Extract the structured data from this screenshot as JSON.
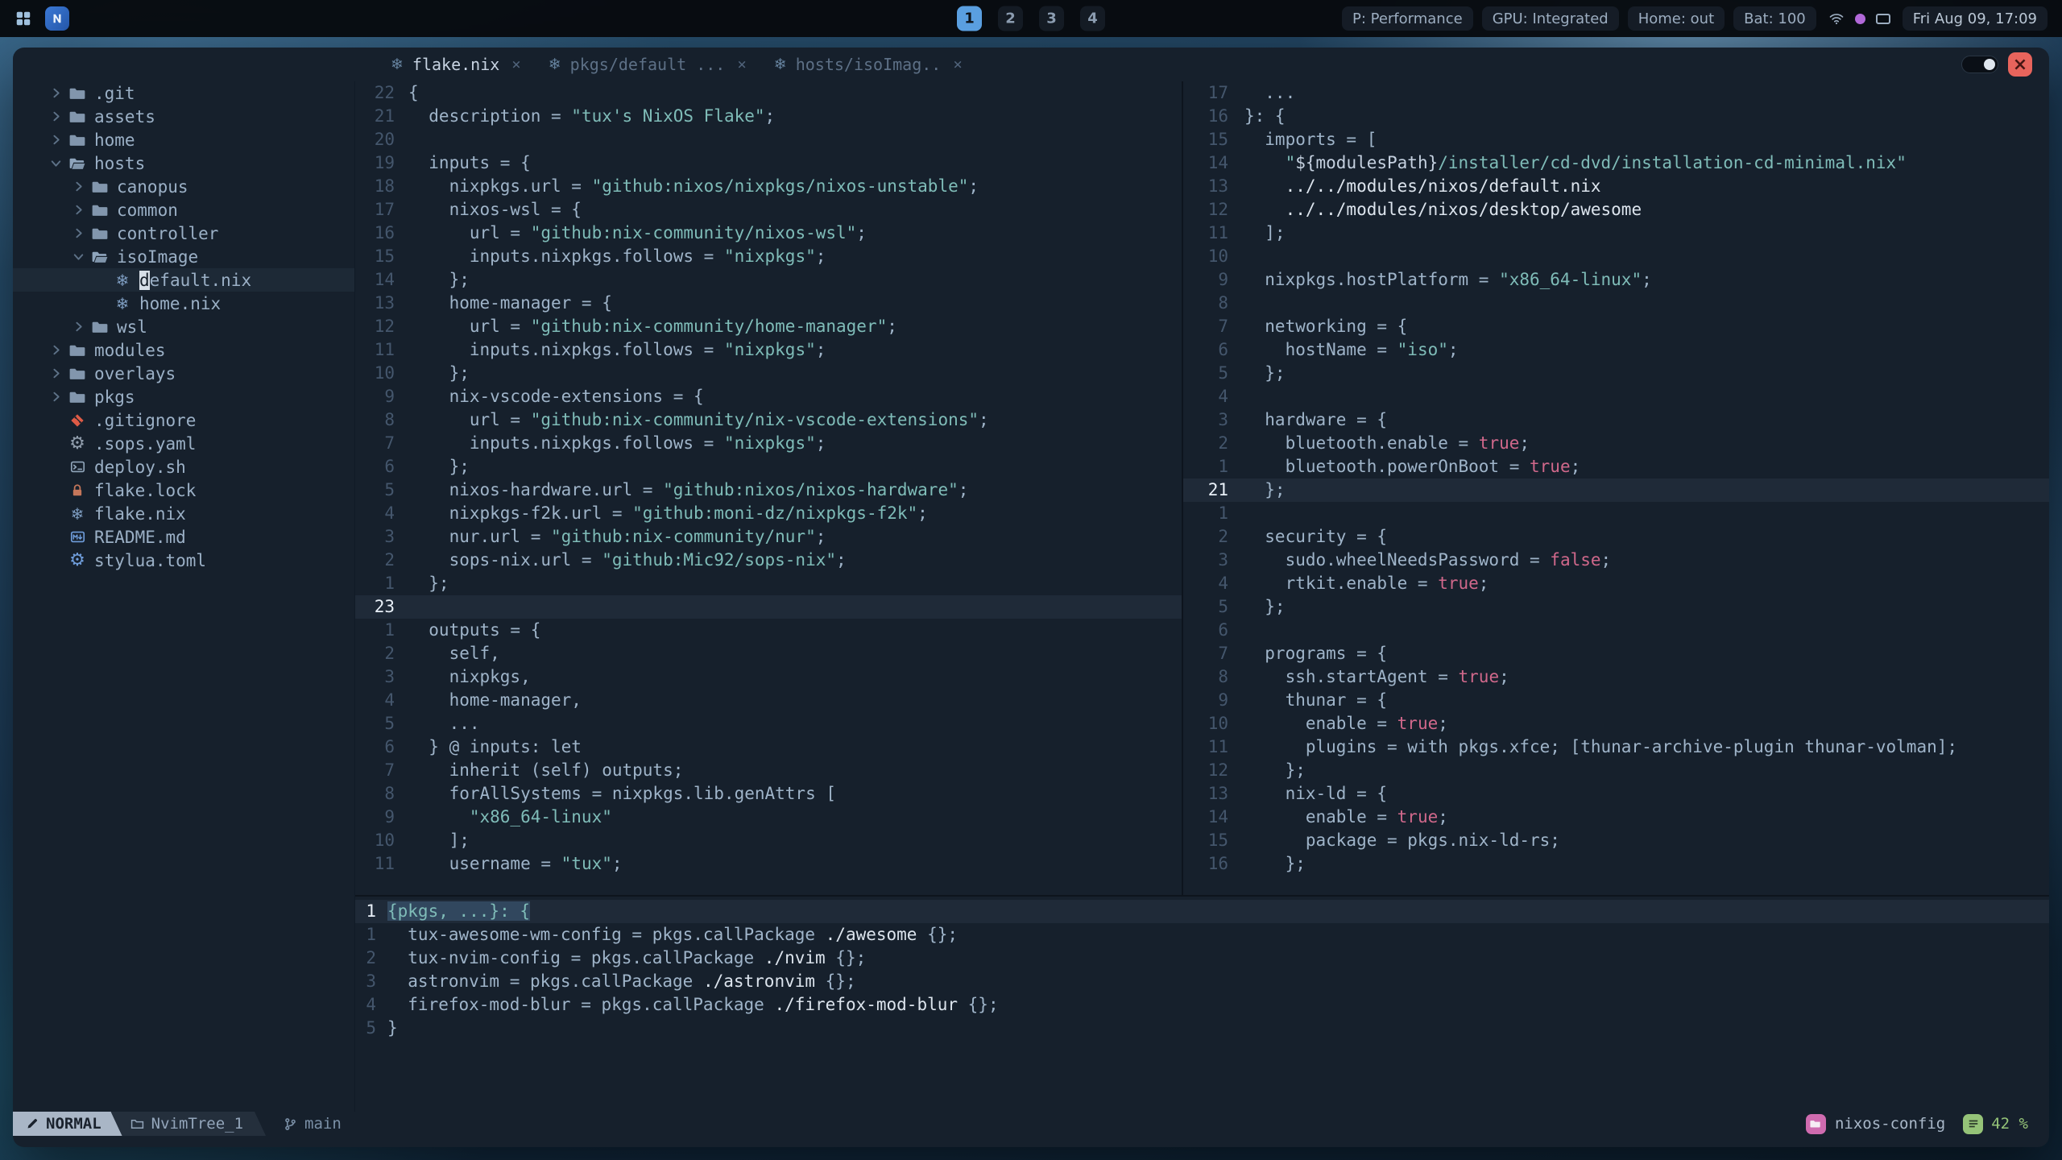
{
  "colors": {
    "accent_blue": "#5a9fe0",
    "string_teal": "#7fbcb8",
    "bool_pink": "#d0688b",
    "close_red": "#e8645c",
    "project_pink": "#cf6baf",
    "percent_green": "#95c378"
  },
  "topbar": {
    "workspaces": [
      {
        "label": "1",
        "active": true
      },
      {
        "label": "2",
        "active": false
      },
      {
        "label": "3",
        "active": false
      },
      {
        "label": "4",
        "active": false
      }
    ],
    "status_items": [
      {
        "label": "P: Performance"
      },
      {
        "label": "GPU: Integrated"
      },
      {
        "label": "Home: out"
      },
      {
        "label": "Bat: 100"
      }
    ],
    "clock": "Fri Aug 09, 17:09"
  },
  "tabline": {
    "tabs": [
      {
        "label": "flake.nix",
        "icon": "nix",
        "active": true
      },
      {
        "label": "pkgs/default ...",
        "icon": "nix",
        "active": false
      },
      {
        "label": "hosts/isoImag..",
        "icon": "nix",
        "active": false
      }
    ]
  },
  "tree": {
    "items": [
      {
        "label": ".git",
        "icon": "folder",
        "chevron": "closed",
        "depth": 0
      },
      {
        "label": "assets",
        "icon": "folder",
        "chevron": "closed",
        "depth": 0
      },
      {
        "label": "home",
        "icon": "folder",
        "chevron": "closed",
        "depth": 0
      },
      {
        "label": "hosts",
        "icon": "folder-open",
        "chevron": "open",
        "depth": 0
      },
      {
        "label": "canopus",
        "icon": "folder",
        "chevron": "closed",
        "depth": 1
      },
      {
        "label": "common",
        "icon": "folder",
        "chevron": "closed",
        "depth": 1
      },
      {
        "label": "controller",
        "icon": "folder",
        "chevron": "closed",
        "depth": 1
      },
      {
        "label": "isoImage",
        "icon": "folder-open",
        "chevron": "open",
        "depth": 1
      },
      {
        "label": "default.nix",
        "icon": "nix",
        "depth": 2,
        "cursor": true
      },
      {
        "label": "home.nix",
        "icon": "nix",
        "depth": 2
      },
      {
        "label": "wsl",
        "icon": "folder",
        "chevron": "closed",
        "depth": 1
      },
      {
        "label": "modules",
        "icon": "folder",
        "chevron": "closed",
        "depth": 0
      },
      {
        "label": "overlays",
        "icon": "folder",
        "chevron": "closed",
        "depth": 0
      },
      {
        "label": "pkgs",
        "icon": "folder",
        "chevron": "closed",
        "depth": 0
      },
      {
        "label": ".gitignore",
        "icon": "git",
        "depth": 0
      },
      {
        "label": ".sops.yaml",
        "icon": "gear-gray",
        "depth": 0
      },
      {
        "label": "deploy.sh",
        "icon": "terminal",
        "depth": 0
      },
      {
        "label": "flake.lock",
        "icon": "lock",
        "depth": 0
      },
      {
        "label": "flake.nix",
        "icon": "nix",
        "depth": 0
      },
      {
        "label": "README.md",
        "icon": "readme",
        "depth": 0
      },
      {
        "label": "stylua.toml",
        "icon": "gear-blue",
        "depth": 0
      }
    ]
  },
  "editors": {
    "flake": {
      "lines": [
        {
          "n": "22",
          "t": "{"
        },
        {
          "n": "21",
          "t": "  description = \"tux's NixOS Flake\";"
        },
        {
          "n": "20",
          "t": ""
        },
        {
          "n": "19",
          "t": "  inputs = {"
        },
        {
          "n": "18",
          "t": "    nixpkgs.url = \"github:nixos/nixpkgs/nixos-unstable\";"
        },
        {
          "n": "17",
          "t": "    nixos-wsl = {"
        },
        {
          "n": "16",
          "t": "      url = \"github:nix-community/nixos-wsl\";"
        },
        {
          "n": "15",
          "t": "      inputs.nixpkgs.follows = \"nixpkgs\";"
        },
        {
          "n": "14",
          "t": "    };"
        },
        {
          "n": "13",
          "t": "    home-manager = {"
        },
        {
          "n": "12",
          "t": "      url = \"github:nix-community/home-manager\";"
        },
        {
          "n": "11",
          "t": "      inputs.nixpkgs.follows = \"nixpkgs\";"
        },
        {
          "n": "10",
          "t": "    };"
        },
        {
          "n": "9",
          "t": "    nix-vscode-extensions = {"
        },
        {
          "n": "8",
          "t": "      url = \"github:nix-community/nix-vscode-extensions\";"
        },
        {
          "n": "7",
          "t": "      inputs.nixpkgs.follows = \"nixpkgs\";"
        },
        {
          "n": "6",
          "t": "    };"
        },
        {
          "n": "5",
          "t": "    nixos-hardware.url = \"github:nixos/nixos-hardware\";"
        },
        {
          "n": "4",
          "t": "    nixpkgs-f2k.url = \"github:moni-dz/nixpkgs-f2k\";"
        },
        {
          "n": "3",
          "t": "    nur.url = \"github:nix-community/nur\";"
        },
        {
          "n": "2",
          "t": "    sops-nix.url = \"github:Mic92/sops-nix\";"
        },
        {
          "n": "1",
          "t": "  };"
        },
        {
          "n": "23",
          "t": "",
          "cur": true
        },
        {
          "n": "1",
          "t": "  outputs = {"
        },
        {
          "n": "2",
          "t": "    self,"
        },
        {
          "n": "3",
          "t": "    nixpkgs,"
        },
        {
          "n": "4",
          "t": "    home-manager,"
        },
        {
          "n": "5",
          "t": "    ..."
        },
        {
          "n": "6",
          "t": "  } @ inputs: let"
        },
        {
          "n": "7",
          "t": "    inherit (self) outputs;"
        },
        {
          "n": "8",
          "t": "    forAllSystems = nixpkgs.lib.genAttrs ["
        },
        {
          "n": "9",
          "t": "      \"x86_64-linux\""
        },
        {
          "n": "10",
          "t": "    ];"
        },
        {
          "n": "11",
          "t": "    username = \"tux\";"
        }
      ]
    },
    "hosts": {
      "lines": [
        {
          "n": "17",
          "t": "  ..."
        },
        {
          "n": "16",
          "t": "}: {"
        },
        {
          "n": "15",
          "t": "  imports = ["
        },
        {
          "n": "14",
          "t": "    \"${modulesPath}/installer/cd-dvd/installation-cd-minimal.nix\""
        },
        {
          "n": "13",
          "t": "    ../../modules/nixos/default.nix"
        },
        {
          "n": "12",
          "t": "    ../../modules/nixos/desktop/awesome"
        },
        {
          "n": "11",
          "t": "  ];"
        },
        {
          "n": "10",
          "t": ""
        },
        {
          "n": "9",
          "t": "  nixpkgs.hostPlatform = \"x86_64-linux\";"
        },
        {
          "n": "8",
          "t": ""
        },
        {
          "n": "7",
          "t": "  networking = {"
        },
        {
          "n": "6",
          "t": "    hostName = \"iso\";"
        },
        {
          "n": "5",
          "t": "  };"
        },
        {
          "n": "4",
          "t": ""
        },
        {
          "n": "3",
          "t": "  hardware = {"
        },
        {
          "n": "2",
          "t": "    bluetooth.enable = true;"
        },
        {
          "n": "1",
          "t": "    bluetooth.powerOnBoot = true;"
        },
        {
          "n": "21",
          "t": "  };",
          "cur": true
        },
        {
          "n": "1",
          "t": ""
        },
        {
          "n": "2",
          "t": "  security = {"
        },
        {
          "n": "3",
          "t": "    sudo.wheelNeedsPassword = false;"
        },
        {
          "n": "4",
          "t": "    rtkit.enable = true;"
        },
        {
          "n": "5",
          "t": "  };"
        },
        {
          "n": "6",
          "t": ""
        },
        {
          "n": "7",
          "t": "  programs = {"
        },
        {
          "n": "8",
          "t": "    ssh.startAgent = true;"
        },
        {
          "n": "9",
          "t": "    thunar = {"
        },
        {
          "n": "10",
          "t": "      enable = true;"
        },
        {
          "n": "11",
          "t": "      plugins = with pkgs.xfce; [thunar-archive-plugin thunar-volman];"
        },
        {
          "n": "12",
          "t": "    };"
        },
        {
          "n": "13",
          "t": "    nix-ld = {"
        },
        {
          "n": "14",
          "t": "      enable = true;"
        },
        {
          "n": "15",
          "t": "      package = pkgs.nix-ld-rs;"
        },
        {
          "n": "16",
          "t": "    };"
        }
      ]
    },
    "pkgs": {
      "lines": [
        {
          "n": "1",
          "t": "{pkgs, ...}: {",
          "cur": true,
          "sel": true
        },
        {
          "n": "1",
          "t": "  tux-awesome-wm-config = pkgs.callPackage ./awesome {};"
        },
        {
          "n": "2",
          "t": "  tux-nvim-config = pkgs.callPackage ./nvim {};"
        },
        {
          "n": "3",
          "t": "  astronvim = pkgs.callPackage ./astronvim {};"
        },
        {
          "n": "4",
          "t": "  firefox-mod-blur = pkgs.callPackage ./firefox-mod-blur {};"
        },
        {
          "n": "5",
          "t": "}"
        }
      ]
    }
  },
  "statusline": {
    "mode": "NORMAL",
    "buffer": "NvimTree_1",
    "branch": "main",
    "project": "nixos-config",
    "scroll": "42 %"
  }
}
